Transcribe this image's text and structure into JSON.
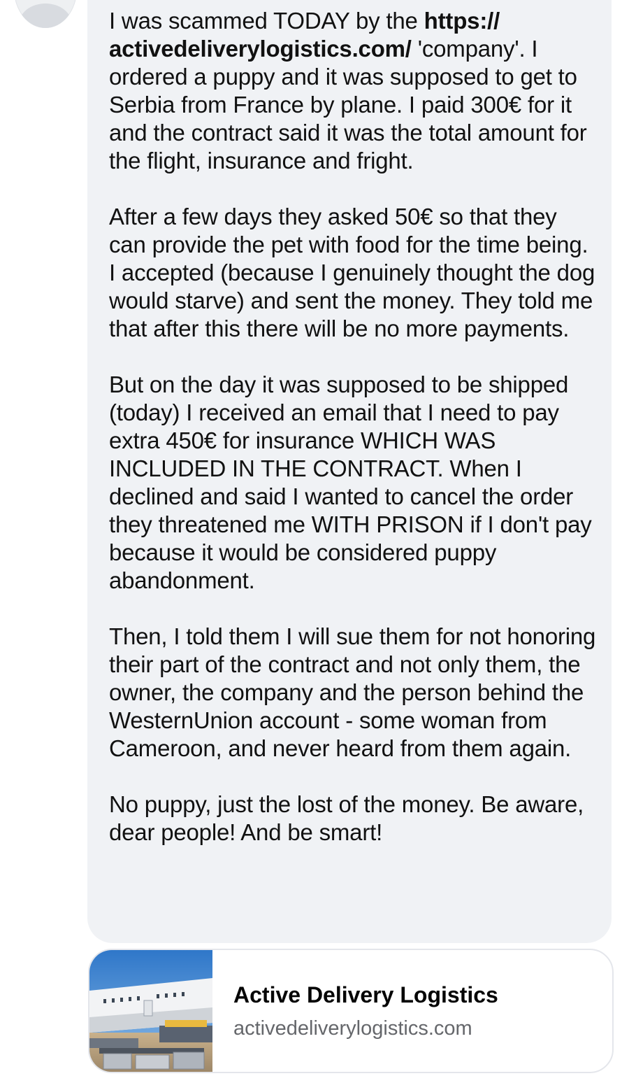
{
  "message": {
    "p1_pre": "I was scammed TODAY by the ",
    "p1_link": "https:// activedeliverylogistics.com/",
    "p1_post": " 'company'. I ordered a puppy and it was supposed to get to Serbia from France by plane. I paid 300€ for it and the contract said it was the total amount for the flight, insurance and fright.",
    "p2": "After a few days they asked 50€ so that they can provide the pet with food for the time being. I accepted (because I genuinely thought the dog would starve) and sent the money. They told me that after this there will be no more payments.",
    "p3": "But on the day it was supposed to be shipped (today) I received an email that I need to pay extra 450€ for insurance WHICH WAS INCLUDED IN THE CONTRACT. When I declined and said I wanted to cancel the order they threatened me WITH PRISON if I don't pay because it would be considered puppy abandonment.",
    "p4": "Then, I told them I will sue them for not honoring their part of the contract and not only them, the owner, the company and the person behind the WesternUnion account - some woman from Cameroon, and never heard from them again.",
    "p5": "No puppy, just the lost of the money. Be aware, dear people! And be smart!"
  },
  "link_preview": {
    "title": "Active Delivery Logistics",
    "domain": "activedeliverylogistics.com",
    "thumbnail_icon": "airplane-cargo-image"
  },
  "colors": {
    "bubble_bg": "#f0f2f5",
    "text": "#050505",
    "secondary_text": "#65676b",
    "card_border": "#e4e6eb"
  }
}
